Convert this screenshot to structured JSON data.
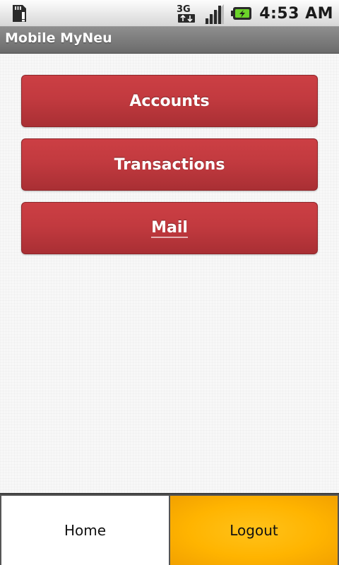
{
  "status_bar": {
    "time": "4:53 AM",
    "network_label": "3G",
    "icons": [
      "sd-card-icon",
      "network-3g-icon",
      "signal-strength-icon",
      "battery-charging-icon"
    ]
  },
  "app": {
    "title": "Mobile MyNeu"
  },
  "menu": {
    "items": [
      {
        "label": "Accounts"
      },
      {
        "label": "Transactions"
      },
      {
        "label": "Mail"
      }
    ],
    "button_color": "#c23a3f"
  },
  "tabs": {
    "home_label": "Home",
    "logout_label": "Logout",
    "active_color": "#ffb400"
  }
}
